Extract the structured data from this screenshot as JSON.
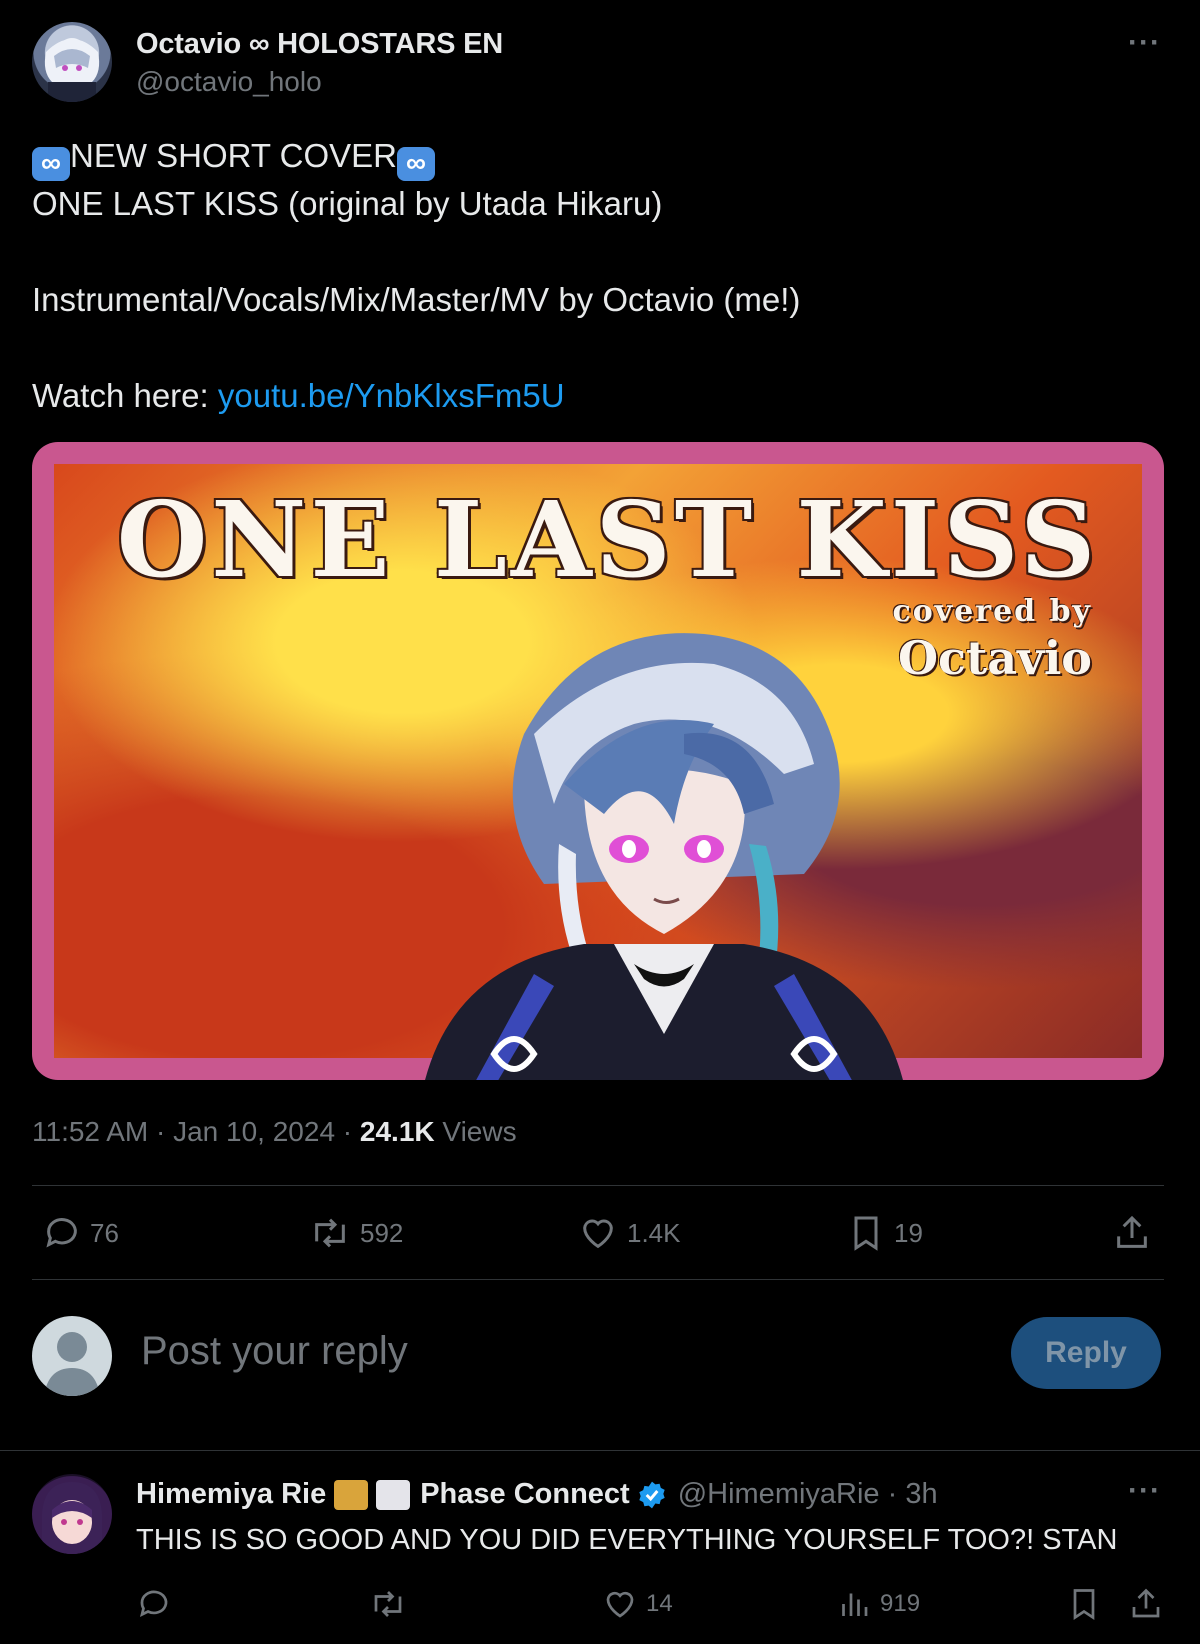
{
  "post": {
    "author_name": "Octavio ∞ HOLOSTARS EN",
    "author_handle": "@octavio_holo",
    "more_label": "···",
    "text_line1_emoji_left": "∞",
    "text_line1": "NEW SHORT COVER",
    "text_line1_emoji_right": "∞",
    "text_line2": "ONE LAST KISS (original by Utada Hikaru)",
    "text_line3": "Instrumental/Vocals/Mix/Master/MV by Octavio (me!)",
    "text_line4_prefix": "Watch here: ",
    "text_link": "youtu.be/YnbKlxsFm5U",
    "thumbnail": {
      "title": "ONE LAST KISS",
      "covered_by": "covered by",
      "artist": "Octavio"
    },
    "time": "11:52 AM · Jan 10, 2024 · ",
    "views_count": "24.1K",
    "views_label": " Views",
    "stats": {
      "replies": "76",
      "reposts": "592",
      "likes": "1.4K",
      "bookmarks": "19"
    }
  },
  "composer": {
    "placeholder": "Post your reply",
    "reply_button": "Reply"
  },
  "reply": {
    "author_name": "Himemiya Rie",
    "author_suffix": "Phase Connect",
    "author_handle": "@HimemiyaRie · 3h",
    "more_label": "···",
    "text": "THIS IS SO GOOD AND YOU DID EVERYTHING YOURSELF TOO?! STAN",
    "stats": {
      "likes": "14",
      "views": "919"
    }
  },
  "colors": {
    "background": "#000000",
    "text": "#e7e9ea",
    "secondary": "#71767b",
    "link": "#1d9bf0",
    "divider": "#2f3336",
    "reply_button_bg": "#1d4f7d",
    "thumbnail_border": "#c9578f"
  }
}
